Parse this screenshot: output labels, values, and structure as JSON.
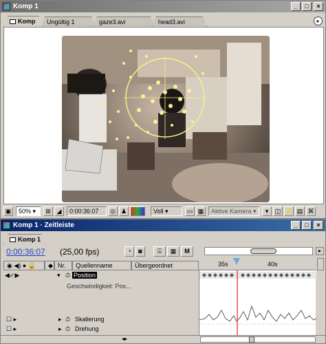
{
  "comp_window": {
    "title": "Komp 1",
    "tabs": [
      {
        "label": "Komp 1"
      },
      {
        "label": "Ungültig 1"
      },
      {
        "label": "gaze3.avi"
      },
      {
        "label": "head3.avi"
      }
    ],
    "controls": {
      "zoom": "50%",
      "timecode": "0:00:36:07",
      "resolution": "Voll",
      "camera": "Aktive Kamera"
    }
  },
  "timeline_window": {
    "title": "Komp 1 · Zeitleiste",
    "tab_label": "Komp 1",
    "current_time": "0:00:36:07",
    "fps": "(25,00 fps)",
    "columns": {
      "nr": "Nr.",
      "source": "Quellenname",
      "parent": "Übergeordnet"
    },
    "ruler": {
      "tick1": "35s",
      "tick2": "40s"
    },
    "layers": [
      {
        "name": "Position",
        "selected": true
      },
      {
        "name": "Geschwindigkeit: Pos..."
      },
      {
        "name": "Skalierung"
      },
      {
        "name": "Drehung"
      }
    ],
    "button_m": "M"
  }
}
